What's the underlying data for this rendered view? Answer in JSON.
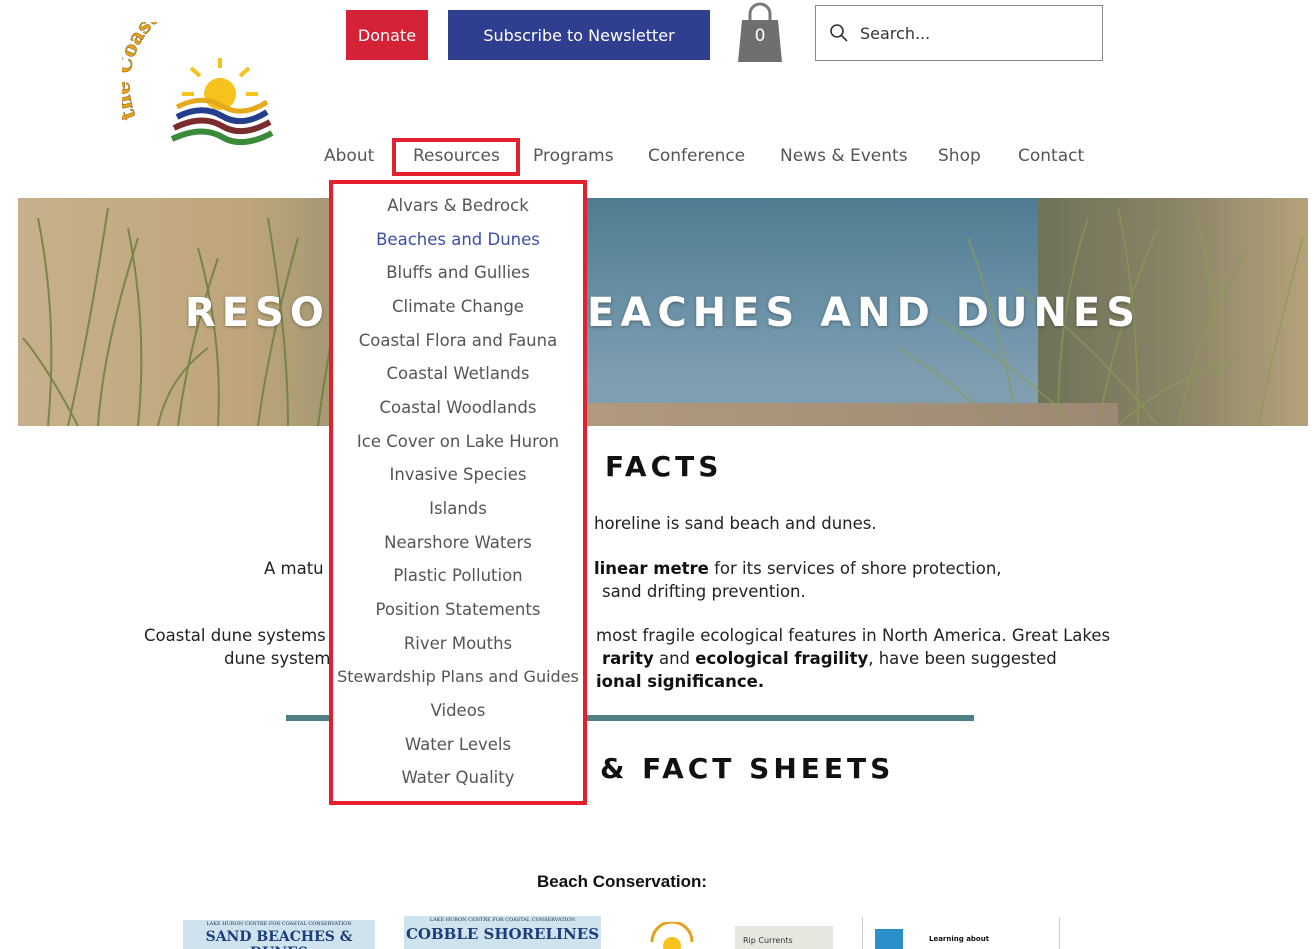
{
  "brand": {
    "logo_text": "the Coastal Centre",
    "colors": {
      "donate": "#d62237",
      "subscribe": "#2f3e8f",
      "highlight": "#e3202e",
      "link_active": "#3b4fa8",
      "divider": "#4d7f84"
    }
  },
  "header": {
    "donate_label": "Donate",
    "subscribe_label": "Subscribe to Newsletter",
    "cart_count": "0",
    "search_placeholder": "Search..."
  },
  "nav": {
    "items": [
      {
        "label": "About"
      },
      {
        "label": "Resources"
      },
      {
        "label": "Programs"
      },
      {
        "label": "Conference"
      },
      {
        "label": "News & Events"
      },
      {
        "label": "Shop"
      },
      {
        "label": "Contact"
      }
    ]
  },
  "dropdown": {
    "items": [
      {
        "label": "Alvars & Bedrock"
      },
      {
        "label": "Beaches and Dunes"
      },
      {
        "label": "Bluffs and Gullies"
      },
      {
        "label": "Climate Change"
      },
      {
        "label": "Coastal Flora and Fauna"
      },
      {
        "label": "Coastal Wetlands"
      },
      {
        "label": "Coastal Woodlands"
      },
      {
        "label": "Ice Cover on Lake Huron"
      },
      {
        "label": "Invasive Species"
      },
      {
        "label": "Islands"
      },
      {
        "label": "Nearshore Waters"
      },
      {
        "label": "Plastic Pollution"
      },
      {
        "label": "Position Statements"
      },
      {
        "label": "River Mouths"
      },
      {
        "label": "Stewardship Plans and Guides"
      },
      {
        "label": "Videos"
      },
      {
        "label": "Water Levels"
      },
      {
        "label": "Water Quality"
      }
    ],
    "active_index": 1
  },
  "hero": {
    "title": "RESOURCES: BEACHES AND DUNES"
  },
  "main": {
    "facts_heading": "FACTS",
    "p1_visible": "horeline is sand beach and dunes.",
    "p2_prefix": "A matu",
    "p2_bold": "linear metre",
    "p2_rest_line1": "for its services of shore protection,",
    "p2_line2": "sand drifting prevention.",
    "p3_prefix_line1": "Coastal dune systems",
    "p3_rest_line1": "most fragile ecological features in North America. Great Lakes",
    "p3_prefix_line2": "dune system",
    "p3_bold_1": "rarity",
    "p3_and": "and",
    "p3_bold_2": "ecological fragility",
    "p3_rest_line2": ", have been suggested",
    "p3_line3_bold": "ional significance.",
    "fact_sheets_heading": "& FACT SHEETS",
    "beach_conservation_label": "Beach Conservation:"
  },
  "thumbnails": [
    {
      "small": "LAKE HURON CENTRE FOR COASTAL CONSERVATION",
      "title": "SAND BEACHES & DUNES"
    },
    {
      "small": "LAKE HURON CENTRE FOR COASTAL CONSERVATION",
      "title": "COBBLE SHORELINES"
    },
    {
      "title": "Rip Currents"
    },
    {
      "title": "Learning about"
    }
  ]
}
